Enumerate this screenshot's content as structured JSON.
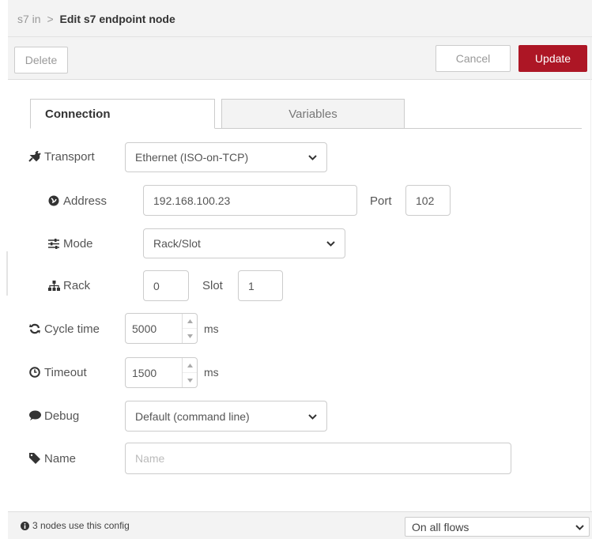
{
  "breadcrumb": {
    "parent": "s7 in",
    "separator": ">",
    "current": "Edit s7 endpoint node"
  },
  "toolbar": {
    "delete_label": "Delete",
    "cancel_label": "Cancel",
    "update_label": "Update"
  },
  "tabs": [
    {
      "label": "Connection",
      "active": true
    },
    {
      "label": "Variables",
      "active": false
    }
  ],
  "form": {
    "transport": {
      "label": "Transport",
      "icon": "plug-icon",
      "value": "Ethernet (ISO-on-TCP)"
    },
    "address": {
      "label": "Address",
      "icon": "globe-icon",
      "value": "192.168.100.23"
    },
    "port": {
      "label": "Port",
      "value": "102"
    },
    "mode": {
      "label": "Mode",
      "icon": "sliders-icon",
      "value": "Rack/Slot"
    },
    "rack": {
      "label": "Rack",
      "icon": "sitemap-icon",
      "value": "0"
    },
    "slot": {
      "label": "Slot",
      "value": "1"
    },
    "cycle_time": {
      "label": "Cycle time",
      "icon": "refresh-icon",
      "value": "5000",
      "unit": "ms"
    },
    "timeout": {
      "label": "Timeout",
      "icon": "clock-icon",
      "value": "1500",
      "unit": "ms"
    },
    "debug": {
      "label": "Debug",
      "icon": "comment-icon",
      "value": "Default (command line)"
    },
    "name": {
      "label": "Name",
      "icon": "tag-icon",
      "value": "",
      "placeholder": "Name"
    }
  },
  "footer": {
    "info_icon": "info-icon",
    "info_text": "3 nodes use this config",
    "scope_value": "On all flows"
  },
  "colors": {
    "accent": "#ad1625",
    "panel": "#f3f3f3",
    "border": "#cccccc"
  }
}
